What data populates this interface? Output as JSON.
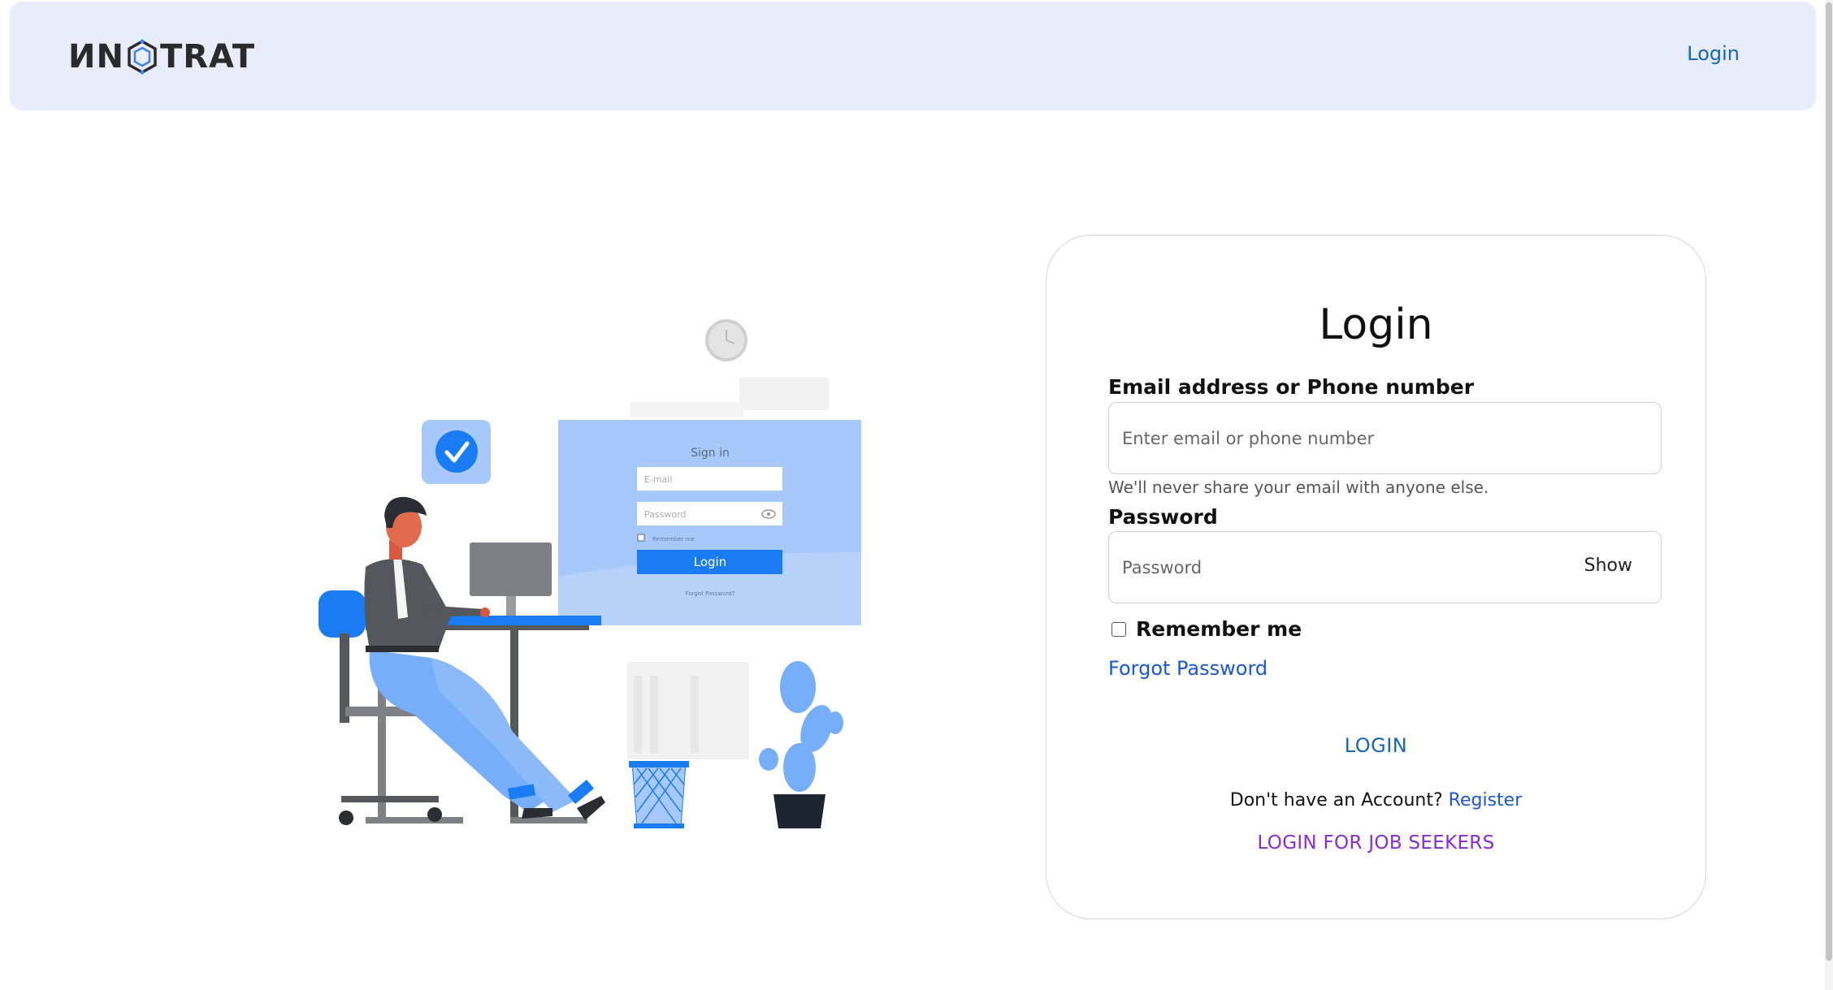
{
  "header": {
    "logo_text_left": "ИN",
    "logo_text_right": "TRAT",
    "nav_login": "Login"
  },
  "illustration": {
    "panel_title": "Sign in",
    "email_placeholder": "E-mail",
    "password_placeholder": "Password",
    "remember_text": "Remember me",
    "login_button": "Login",
    "forgot_text": "Forgot Password?"
  },
  "login": {
    "title": "Login",
    "email_label": "Email address or Phone number",
    "email_placeholder": "Enter email or phone number",
    "email_value": "",
    "help_text": "We'll never share your email with anyone else.",
    "password_label": "Password",
    "password_placeholder": "Password",
    "password_value": "",
    "show_label": "Show",
    "remember_label": "Remember me",
    "remember_checked": false,
    "forgot_label": "Forgot Password",
    "login_button": "LOGIN",
    "no_account_text": "Don't have an Account?",
    "register_label": "Register",
    "job_seekers_label": "LOGIN FOR JOB SEEKERS"
  },
  "colors": {
    "header_bg": "#e9ecfb",
    "link_blue": "#1565c0",
    "purple": "#8a2bd8",
    "illustration_blue": "#1a7cf5"
  }
}
